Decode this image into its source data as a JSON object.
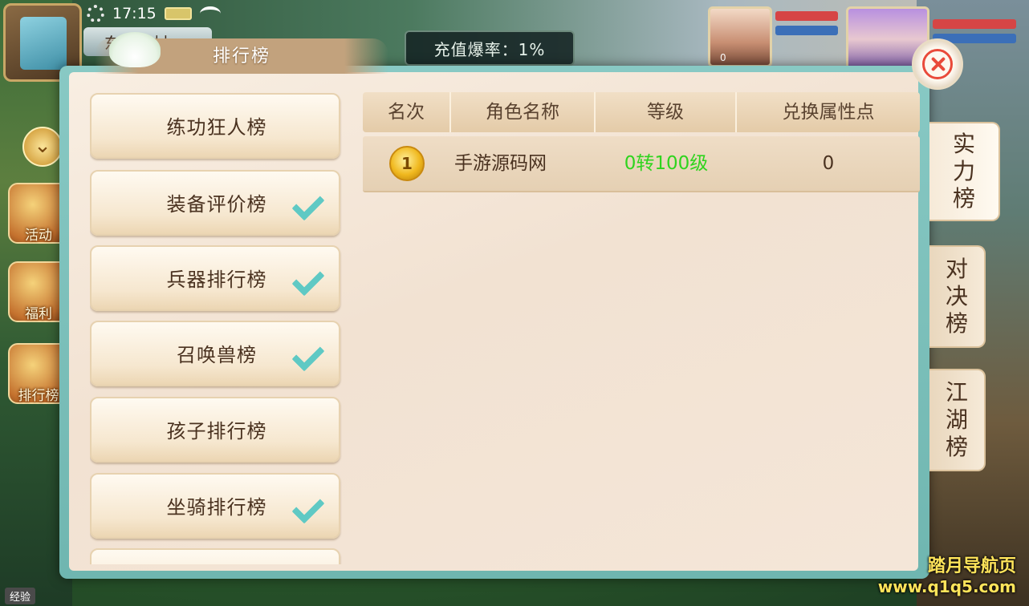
{
  "status": {
    "time": "17:15"
  },
  "hud": {
    "location": "东海渔村",
    "recharge_rate": "充值爆率：1%",
    "side_icons": [
      {
        "label": "活动"
      },
      {
        "label": "福利"
      },
      {
        "label": "排行榜"
      }
    ],
    "exp_label": "经验",
    "portrait_level": "0",
    "watermark_line1": "踏月导航页",
    "watermark_line2": "www.q1q5.com"
  },
  "panel": {
    "title": "排行榜",
    "categories": [
      {
        "label": "练功狂人榜",
        "has_dropdown": false
      },
      {
        "label": "装备评价榜",
        "has_dropdown": true
      },
      {
        "label": "兵器排行榜",
        "has_dropdown": true
      },
      {
        "label": "召唤兽榜",
        "has_dropdown": true
      },
      {
        "label": "孩子排行榜",
        "has_dropdown": false
      },
      {
        "label": "坐骑排行榜",
        "has_dropdown": true
      }
    ],
    "table": {
      "headers": [
        "名次",
        "角色名称",
        "等级",
        "兑换属性点"
      ],
      "rows": [
        {
          "rank": "1",
          "name": "手游源码网",
          "level": "0转100级",
          "points": "0"
        }
      ]
    },
    "tabs": [
      {
        "label": "实力榜",
        "chars": [
          "实",
          "力",
          "榜"
        ],
        "active": true
      },
      {
        "label": "对决榜",
        "chars": [
          "对",
          "决",
          "榜"
        ],
        "active": false
      },
      {
        "label": "江湖榜",
        "chars": [
          "江",
          "湖",
          "榜"
        ],
        "active": false
      }
    ]
  },
  "colors": {
    "level_green": "#2fd41e",
    "arrow_teal": "#5fc9c4",
    "close_red": "#e94a3a",
    "text_brown": "#4a3220"
  }
}
